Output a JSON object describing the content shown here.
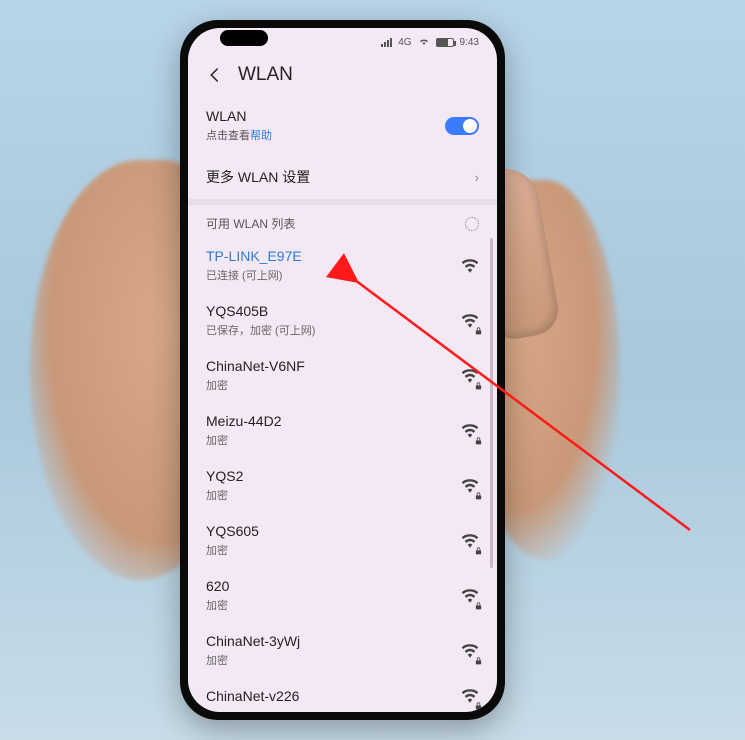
{
  "statusbar": {
    "signal": "4G",
    "time": "9:43"
  },
  "header": {
    "title": "WLAN"
  },
  "wlan_toggle": {
    "title": "WLAN",
    "sub_prefix": "点击查看",
    "sub_link": "帮助"
  },
  "more_settings": {
    "title": "更多 WLAN 设置"
  },
  "available": {
    "header": "可用 WLAN 列表"
  },
  "networks": [
    {
      "name": "TP-LINK_E97E",
      "status": "已连接 (可上网)",
      "highlighted": true,
      "locked": false
    },
    {
      "name": "YQS405B",
      "status": "已保存，加密 (可上网)",
      "highlighted": false,
      "locked": true
    },
    {
      "name": "ChinaNet-V6NF",
      "status": "加密",
      "highlighted": false,
      "locked": true
    },
    {
      "name": "Meizu-44D2",
      "status": "加密",
      "highlighted": false,
      "locked": true
    },
    {
      "name": "YQS2",
      "status": "加密",
      "highlighted": false,
      "locked": true
    },
    {
      "name": "YQS605",
      "status": "加密",
      "highlighted": false,
      "locked": true
    },
    {
      "name": "620",
      "status": "加密",
      "highlighted": false,
      "locked": true
    },
    {
      "name": "ChinaNet-3yWj",
      "status": "加密",
      "highlighted": false,
      "locked": true
    },
    {
      "name": "ChinaNet-v226",
      "status": "",
      "highlighted": false,
      "locked": true
    }
  ]
}
